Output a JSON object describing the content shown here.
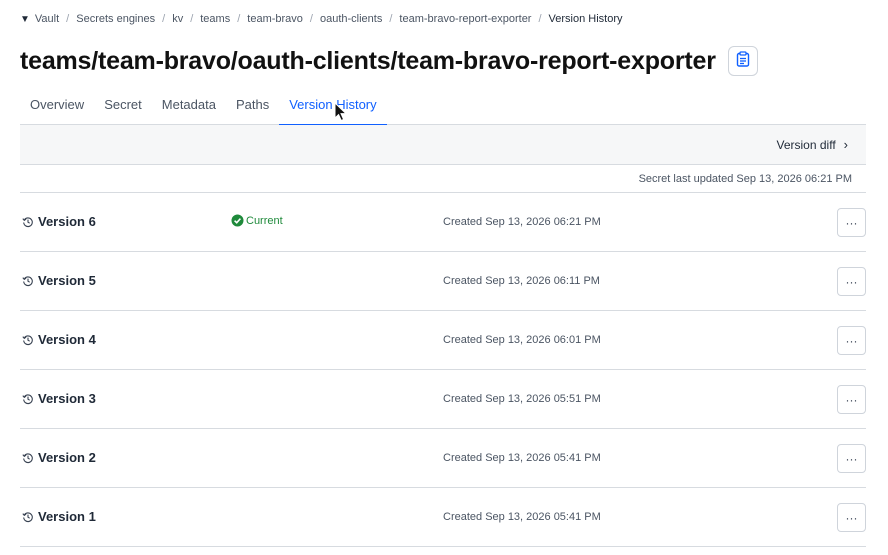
{
  "breadcrumb": {
    "logo_icon": "vault-triangle-icon",
    "items": [
      "Vault",
      "Secrets engines",
      "kv",
      "teams",
      "team-bravo",
      "oauth-clients",
      "team-bravo-report-exporter",
      "Version History"
    ],
    "separator": "/"
  },
  "header": {
    "title": "teams/team-bravo/oauth-clients/team-bravo-report-exporter",
    "copy_icon": "clipboard-icon"
  },
  "tabs": [
    "Overview",
    "Secret",
    "Metadata",
    "Paths",
    "Version History"
  ],
  "active_tab": "Version History",
  "toolbar": {
    "version_diff_label": "Version diff",
    "chevron": "›"
  },
  "last_updated": "Secret last updated Sep 13, 2026 06:21 PM",
  "versions": [
    {
      "label": "Version 6",
      "current": "Current",
      "created": "Created Sep 13, 2026 06:21 PM"
    },
    {
      "label": "Version 5",
      "current": "",
      "created": "Created Sep 13, 2026 06:11 PM"
    },
    {
      "label": "Version 4",
      "current": "",
      "created": "Created Sep 13, 2026 06:01 PM"
    },
    {
      "label": "Version 3",
      "current": "",
      "created": "Created Sep 13, 2026 05:51 PM"
    },
    {
      "label": "Version 2",
      "current": "",
      "created": "Created Sep 13, 2026 05:41 PM"
    },
    {
      "label": "Version 1",
      "current": "",
      "created": "Created Sep 13, 2026 05:41 PM"
    }
  ],
  "more_label": "···",
  "colors": {
    "accent": "#1060ff",
    "success": "#1f8a3b",
    "border": "#d7dbe0",
    "toolbar_bg": "#f6f7f8"
  }
}
